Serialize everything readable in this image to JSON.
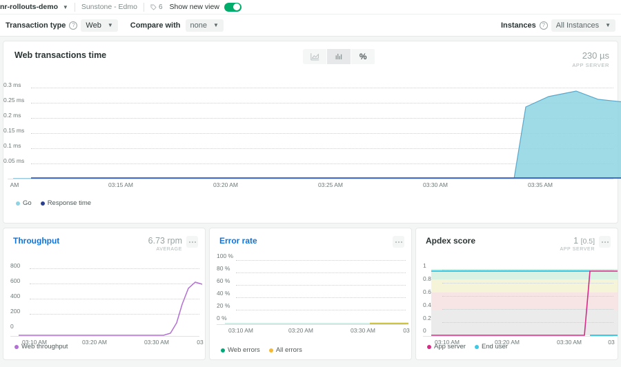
{
  "topbar": {
    "app_name": "nr-rollouts-demo",
    "account": "Sunstone - Edmo",
    "tag_count": "6",
    "show_new_view_label": "Show new view",
    "toggle_state": "on"
  },
  "filterbar": {
    "transaction_type_label": "Transaction type",
    "transaction_type_value": "Web",
    "compare_with_label": "Compare with",
    "compare_with_value": "none",
    "instances_label": "Instances",
    "instances_value": "All Instances"
  },
  "main_chart": {
    "title": "Web transactions time",
    "view_buttons": [
      "area-chart-icon",
      "bar-chart-icon",
      "%"
    ],
    "selected_view": "bar-chart-icon",
    "metric_value": "230 µs",
    "metric_sublabel": "APP SERVER"
  },
  "panels": [
    {
      "title": "Throughput",
      "title_is_link": "true",
      "metric_value": "6.73 rpm",
      "metric_sublabel": "AVERAGE"
    },
    {
      "title": "Error rate",
      "title_is_link": "true",
      "metric_value": "",
      "metric_sublabel": ""
    },
    {
      "title": "Apdex score",
      "title_is_link": "false",
      "metric_value": "1",
      "metric_value_bracket": "[0.5]",
      "metric_sublabel": "APP SERVER"
    }
  ],
  "colors": {
    "accent_link": "#0c74df",
    "toggle_on": "#00ac69",
    "go_series": "#8ed3e3",
    "response_time_series": "#3a5bbf",
    "web_throughput_series": "#b36fd4",
    "web_errors_series": "#00a878",
    "all_errors_series": "#f5b935",
    "app_server_series": "#d62a86",
    "end_user_series": "#3fc8e4"
  },
  "chart_data": [
    {
      "type": "area",
      "title": "Web transactions time",
      "xlabel": "",
      "ylabel": "",
      "ylim": [
        0,
        0.325
      ],
      "yticks": [
        "0.05 ms",
        "0.1 ms",
        "0.15 ms",
        "0.2 ms",
        "0.25 ms",
        "0.3 ms"
      ],
      "ytick_values": [
        0.05,
        0.1,
        0.15,
        0.2,
        0.25,
        0.3
      ],
      "xticks": [
        "AM",
        "03:15 AM",
        "03:20 AM",
        "03:25 AM",
        "03:30 AM",
        "03:35 AM"
      ],
      "xtick_values": [
        3.1667,
        3.25,
        3.3333,
        3.4167,
        3.5,
        3.5833
      ],
      "grid": true,
      "legend": [
        {
          "name": "Go",
          "color": "#8ed3e3"
        },
        {
          "name": "Response time",
          "color": "#3a5bbf"
        }
      ],
      "series": [
        {
          "name": "Go",
          "color": "#8ed3e3",
          "x": [
            3.1667,
            3.25,
            3.3333,
            3.4167,
            3.5,
            3.543,
            3.553,
            3.566,
            3.583,
            3.6,
            3.617,
            3.633
          ],
          "values": [
            0.0,
            0.0,
            0.0,
            0.0,
            0.0,
            0.0,
            0.205,
            0.235,
            0.252,
            0.262,
            0.244,
            0.238
          ]
        },
        {
          "name": "Response time",
          "color": "#3a5bbf",
          "x": [
            3.1667,
            3.25,
            3.3333,
            3.4167,
            3.5,
            3.543,
            3.583,
            3.633
          ],
          "values": [
            0.002,
            0.002,
            0.002,
            0.002,
            0.002,
            0.002,
            0.002,
            0.002
          ]
        }
      ]
    },
    {
      "type": "line",
      "title": "Throughput",
      "ylim": [
        0,
        880
      ],
      "yticks": [
        "0",
        "200",
        "400",
        "600",
        "800"
      ],
      "ytick_values": [
        0,
        200,
        400,
        600,
        800
      ],
      "xticks": [
        "03:10 AM",
        "03:20 AM",
        "03:30 AM",
        "03"
      ],
      "xtick_values": [
        3.1667,
        3.3333,
        3.5,
        3.633
      ],
      "grid": true,
      "legend": [
        {
          "name": "Web throughput",
          "color": "#b36fd4"
        }
      ],
      "series": [
        {
          "name": "Web throughput",
          "color": "#b36fd4",
          "x": [
            3.1667,
            3.25,
            3.3333,
            3.4167,
            3.5,
            3.533,
            3.55,
            3.566,
            3.583,
            3.6,
            3.617,
            3.633
          ],
          "values": [
            4,
            4,
            4,
            4,
            4,
            6,
            30,
            140,
            330,
            470,
            545,
            520
          ]
        }
      ]
    },
    {
      "type": "line",
      "title": "Error rate",
      "ylim": [
        0,
        110
      ],
      "yticks": [
        "0 %",
        "20 %",
        "40 %",
        "60 %",
        "80 %",
        "100 %"
      ],
      "ytick_values": [
        0,
        20,
        40,
        60,
        80,
        100
      ],
      "xticks": [
        "03:10 AM",
        "03:20 AM",
        "03:30 AM",
        "03"
      ],
      "xtick_values": [
        3.1667,
        3.3333,
        3.5,
        3.633
      ],
      "grid": true,
      "legend": [
        {
          "name": "Web errors",
          "color": "#00a878"
        },
        {
          "name": "All errors",
          "color": "#f5b935"
        }
      ],
      "series": [
        {
          "name": "Web errors",
          "color": "#00a878",
          "x": [
            3.1667,
            3.3333,
            3.5,
            3.633
          ],
          "values": [
            0,
            0,
            0,
            0
          ]
        },
        {
          "name": "All errors",
          "color": "#f5b935",
          "x": [
            3.555,
            3.6,
            3.633
          ],
          "values": [
            0,
            0,
            0
          ]
        }
      ]
    },
    {
      "type": "line",
      "title": "Apdex score",
      "ylim": [
        0,
        1.08
      ],
      "yticks": [
        "0",
        "0.2",
        "0.4",
        "0.6",
        "0.8",
        "1"
      ],
      "ytick_values": [
        0,
        0.2,
        0.4,
        0.6,
        0.8,
        1
      ],
      "xticks": [
        "03:10 AM",
        "03:20 AM",
        "03:30 AM",
        "03"
      ],
      "xtick_values": [
        3.1667,
        3.3333,
        3.5,
        3.633
      ],
      "grid": true,
      "bands": [
        {
          "from": 0.85,
          "to": 0.94,
          "color": "#d9f2e4"
        },
        {
          "from": 0.7,
          "to": 0.85,
          "color": "#f6f4d8"
        },
        {
          "from": 0.5,
          "to": 0.7,
          "color": "#f7e4e4"
        },
        {
          "from": 0.0,
          "to": 0.5,
          "color": "#ebebeb"
        }
      ],
      "legend": [
        {
          "name": "App server",
          "color": "#d62a86"
        },
        {
          "name": "End user",
          "color": "#3fc8e4"
        }
      ],
      "series": [
        {
          "name": "App server",
          "color": "#d62a86",
          "x": [
            3.1667,
            3.3333,
            3.5,
            3.545,
            3.556,
            3.583,
            3.633
          ],
          "values": [
            0,
            0,
            0,
            0,
            0.94,
            0.94,
            0.94
          ]
        },
        {
          "name": "End user",
          "color": "#3fc8e4",
          "x": [
            3.1667,
            3.3333,
            3.5,
            3.545,
            3.556,
            3.583,
            3.633
          ],
          "values": [
            0.94,
            0.94,
            0.94,
            0.94,
            0,
            0,
            0
          ]
        }
      ]
    }
  ]
}
